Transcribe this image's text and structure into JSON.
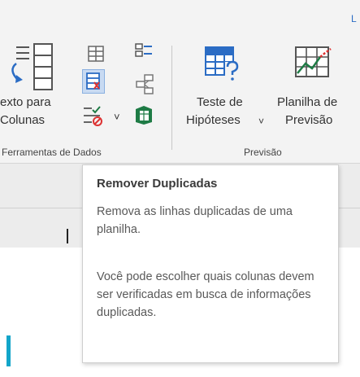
{
  "ribbon": {
    "corner_letter": "L",
    "text_to_columns": {
      "line1": "exto para",
      "line2": "Colunas"
    },
    "what_if": {
      "line1": "Teste de",
      "line2": "Hipóteses",
      "caret": "˅"
    },
    "forecast_sheet": {
      "line1": "Planilha de",
      "line2": "Previsão"
    },
    "groups": {
      "data_tools": "Ferramentas de Dados",
      "forecast": "Previsão"
    },
    "dropdown_caret": "˅"
  },
  "tooltip": {
    "title": "Remover Duplicadas",
    "paragraph1": "Remova as linhas duplicadas de uma planilha.",
    "paragraph2": "Você pode escolher quais colunas devem ser verificadas em busca de informações duplicadas."
  },
  "colors": {
    "accent_blue": "#2b6cc4",
    "excel_green": "#1e7b45",
    "cell_cursor": "#12a5c9"
  },
  "icons": [
    "text-to-columns-icon",
    "flash-fill-icon",
    "remove-duplicates-icon",
    "data-validation-icon",
    "consolidate-icon",
    "relationships-icon",
    "manage-data-model-icon",
    "what-if-analysis-icon",
    "forecast-sheet-icon"
  ]
}
